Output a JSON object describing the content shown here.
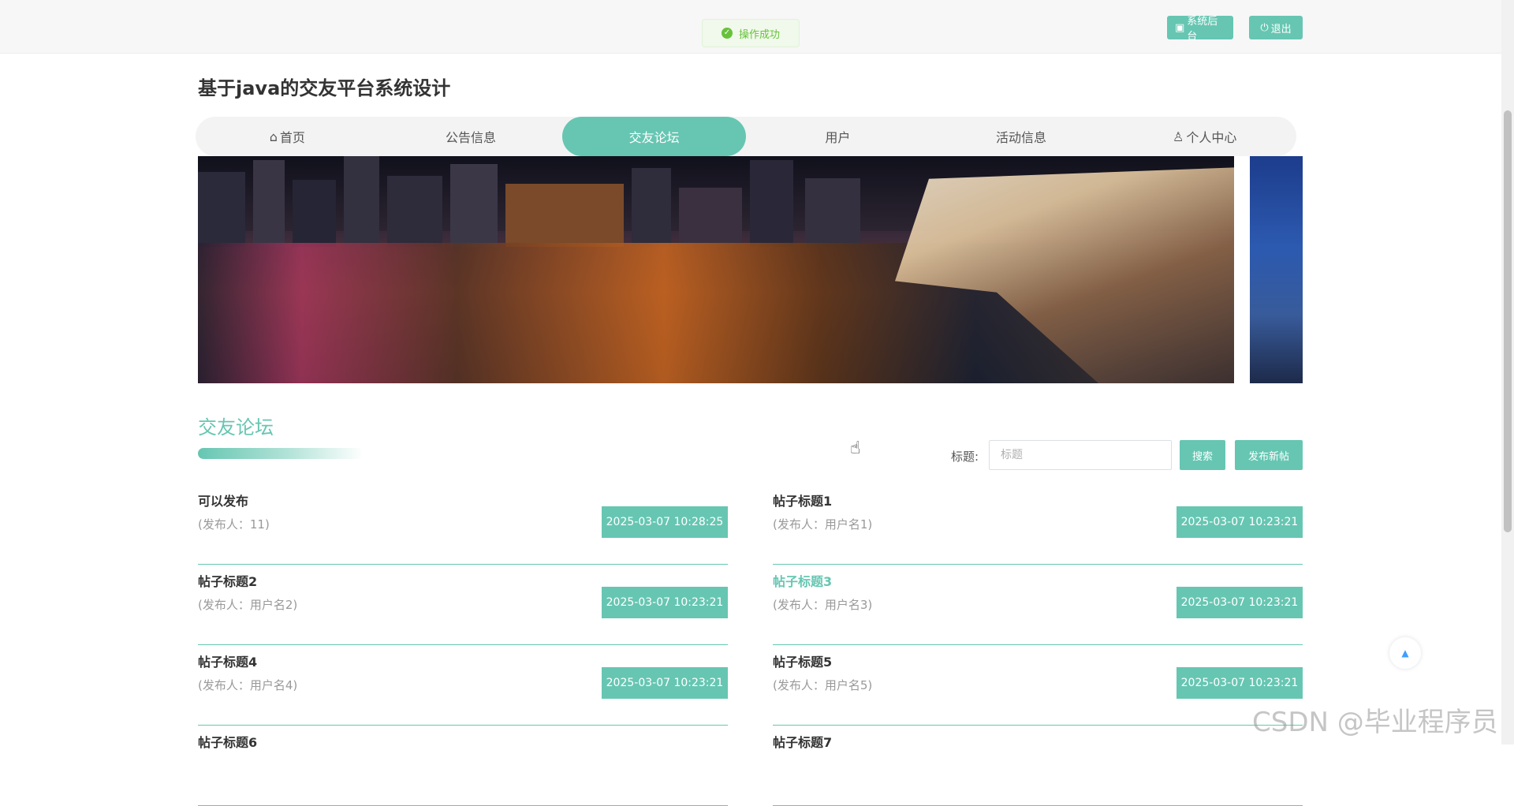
{
  "toast": {
    "text": "操作成功",
    "icon": "check-circle-icon",
    "color": "#67c23a"
  },
  "topbar": {
    "admin_label": "系统后台",
    "logout_label": "退出"
  },
  "site_title": "基于java的交友平台系统设计",
  "nav": [
    {
      "label": "首页",
      "icon": "home-icon",
      "active": false
    },
    {
      "label": "公告信息",
      "active": false
    },
    {
      "label": "交友论坛",
      "active": true
    },
    {
      "label": "用户",
      "active": false
    },
    {
      "label": "活动信息",
      "active": false
    },
    {
      "label": "个人中心",
      "icon": "user-icon",
      "active": false
    }
  ],
  "section": {
    "title": "交友论坛"
  },
  "search": {
    "label": "标题:",
    "placeholder": "标题",
    "button_label": "搜索",
    "publish_label": "发布新帖"
  },
  "posts": [
    {
      "title": "可以发布",
      "author": "(发布人：11)",
      "date": "2025-03-07 10:28:25"
    },
    {
      "title": "帖子标题1",
      "author": "(发布人：用户名1)",
      "date": "2025-03-07 10:23:21"
    },
    {
      "title": "帖子标题2",
      "author": "(发布人：用户名2)",
      "date": "2025-03-07 10:23:21"
    },
    {
      "title": "帖子标题3",
      "author": "(发布人：用户名3)",
      "date": "2025-03-07 10:23:21",
      "highlighted": true
    },
    {
      "title": "帖子标题4",
      "author": "(发布人：用户名4)",
      "date": "2025-03-07 10:23:21"
    },
    {
      "title": "帖子标题5",
      "author": "(发布人：用户名5)",
      "date": "2025-03-07 10:23:21"
    },
    {
      "title": "帖子标题6",
      "author": "",
      "date": ""
    },
    {
      "title": "帖子标题7",
      "author": "",
      "date": ""
    }
  ],
  "watermark": "CSDN @毕业程序员",
  "colors": {
    "accent": "#66c6b2",
    "success": "#67c23a",
    "backtop": "#409eff"
  }
}
